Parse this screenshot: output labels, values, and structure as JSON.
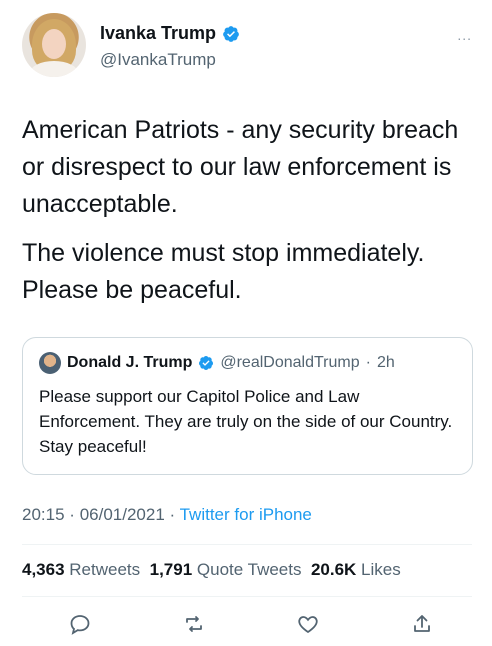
{
  "author": {
    "name": "Ivanka Trump",
    "handle": "@IvankaTrump",
    "verified_icon": "verified-badge-icon",
    "more_icon": "..."
  },
  "tweet": {
    "paragraph1": "American Patriots - any security breach or disrespect to our law enforcement is unacceptable.",
    "paragraph2": "The violence must stop immediately. Please be peaceful."
  },
  "quote": {
    "name": "Donald J. Trump",
    "handle": "@realDonaldTrump",
    "dot": "·",
    "time": "2h",
    "text": "Please support our Capitol Police and Law Enforcement. They are truly on the side of our Country. Stay peaceful!"
  },
  "meta": {
    "time": "20:15",
    "sep1": "·",
    "date": "06/01/2021",
    "sep2": "·",
    "source": "Twitter for iPhone"
  },
  "stats": {
    "retweets_count": "4,363",
    "retweets_label": "Retweets",
    "quotes_count": "1,791",
    "quotes_label": "Quote Tweets",
    "likes_count": "20.6K",
    "likes_label": "Likes"
  },
  "colors": {
    "accent": "#1d9bf0",
    "text": "#0f1419",
    "secondary": "#536471",
    "border": "#cfd9de"
  }
}
